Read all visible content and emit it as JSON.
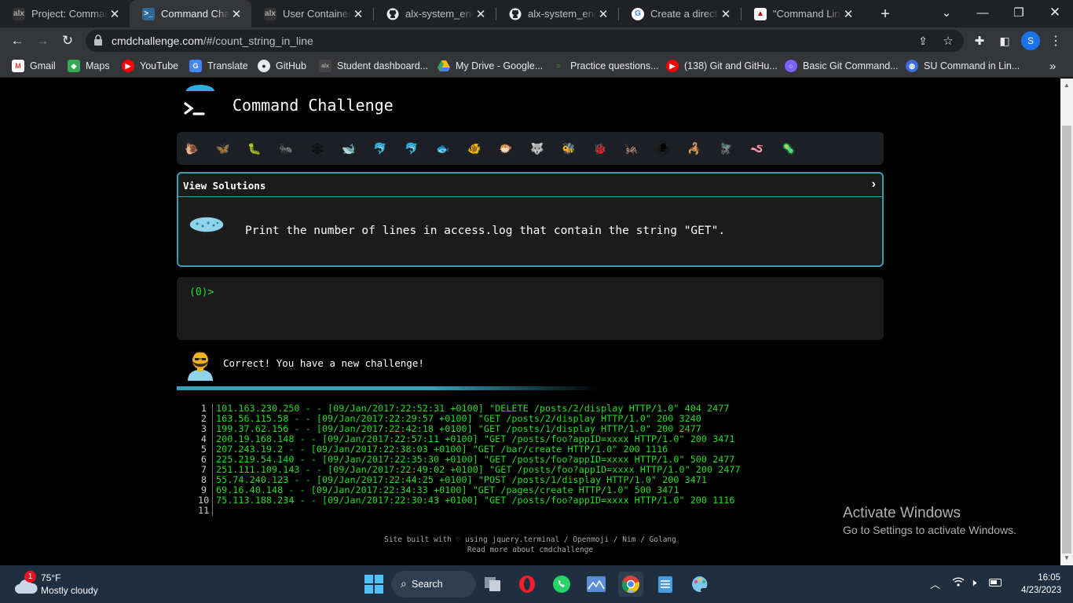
{
  "browser": {
    "tabs": [
      {
        "title": "Project: Comman",
        "active": false,
        "favicon": "alx-icon"
      },
      {
        "title": "Command Challe",
        "active": true,
        "favicon": "terminal-icon"
      },
      {
        "title": "User Containers -",
        "active": false,
        "favicon": "alx-icon"
      },
      {
        "title": "alx-system_engin",
        "active": false,
        "favicon": "github-icon"
      },
      {
        "title": "alx-system_engin",
        "active": false,
        "favicon": "github-icon"
      },
      {
        "title": "Create a directory",
        "active": false,
        "favicon": "google-icon"
      },
      {
        "title": "\"Command Line C",
        "active": false,
        "favicon": "page-icon"
      }
    ],
    "url_domain": "cmdchallenge.com",
    "url_path": "/#/count_string_in_line",
    "profile_initial": "S",
    "bookmarks": [
      {
        "label": "Gmail",
        "icon": "gmail-icon",
        "color": "#ea4335"
      },
      {
        "label": "Maps",
        "icon": "maps-icon",
        "color": "#34a853"
      },
      {
        "label": "YouTube",
        "icon": "youtube-icon",
        "color": "#ff0000"
      },
      {
        "label": "Translate",
        "icon": "translate-icon",
        "color": "#4285f4"
      },
      {
        "label": "GitHub",
        "icon": "github-icon",
        "color": "#ffffff"
      },
      {
        "label": "Student dashboard...",
        "icon": "alx-icon",
        "color": "#444444"
      },
      {
        "label": "My Drive - Google...",
        "icon": "drive-icon",
        "color": "#fbbc04"
      },
      {
        "label": "Practice questions...",
        "icon": "practice-icon",
        "color": "#2d8c3c"
      },
      {
        "label": "(138) Git and GitHu...",
        "icon": "youtube-icon",
        "color": "#ff0000"
      },
      {
        "label": "Basic Git Command...",
        "icon": "circle-icon",
        "color": "#7b61ff"
      },
      {
        "label": "SU Command in Lin...",
        "icon": "globe-icon",
        "color": "#3b6fd8"
      }
    ]
  },
  "page": {
    "site_title": "Command Challenge",
    "critters": [
      "🐌",
      "🦋",
      "🐛",
      "🐜",
      "🕸",
      "🐋",
      "🐬",
      "🐬",
      "🐟",
      "🐠",
      "🐡",
      "🐺",
      "🐝",
      "🐞",
      "🦗",
      "🕷",
      "🦂",
      "🪰",
      "🪱",
      "🦠"
    ],
    "view_solutions_label": "View Solutions",
    "challenge_text": "Print the number of lines in access.log that contain the string \"GET\".",
    "prompt": "(0)>",
    "feedback": "Correct! You have a new challenge!",
    "log_lines": [
      {
        "n": "1",
        "text": "101.163.230.250 - - [09/Jan/2017:22:52:31 +0100] \"DELETE /posts/2/display HTTP/1.0\" 404 2477"
      },
      {
        "n": "2",
        "text": "163.56.115.58 - - [09/Jan/2017:22:29:57 +0100] \"GET /posts/2/display HTTP/1.0\" 200 3240"
      },
      {
        "n": "3",
        "text": "199.37.62.156 - - [09/Jan/2017:22:42:18 +0100] \"GET /posts/1/display HTTP/1.0\" 200 2477"
      },
      {
        "n": "4",
        "text": "200.19.168.148 - - [09/Jan/2017:22:57:11 +0100] \"GET /posts/foo?appID=xxxx HTTP/1.0\" 200 3471"
      },
      {
        "n": "5",
        "text": "207.243.19.2 - - [09/Jan/2017:22:38:03 +0100] \"GET /bar/create HTTP/1.0\" 200 1116"
      },
      {
        "n": "6",
        "text": "225.219.54.140 - - [09/Jan/2017:22:35:30 +0100] \"GET /posts/foo?appID=xxxx HTTP/1.0\" 500 2477"
      },
      {
        "n": "7",
        "text": "251.111.109.143 - - [09/Jan/2017:22:49:02 +0100] \"GET /posts/foo?appID=xxxx HTTP/1.0\" 200 2477"
      },
      {
        "n": "8",
        "text": "55.74.240.123 - - [09/Jan/2017:22:44:25 +0100] \"POST /posts/1/display HTTP/1.0\" 200 3471"
      },
      {
        "n": "9",
        "text": "69.16.40.148 - - [09/Jan/2017:22:34:33 +0100] \"GET /pages/create HTTP/1.0\" 500 3471"
      },
      {
        "n": "10",
        "text": "75.113.188.234 - - [09/Jan/2017:22:30:43 +0100] \"GET /posts/foo?appID=xxxx HTTP/1.0\" 200 1116"
      },
      {
        "n": "11",
        "text": ""
      }
    ],
    "footer_line1": "Site built with ♡ using jquery.terminal / Openmoji / Nim / Golang",
    "footer_line2": "Read more about cmdchallenge"
  },
  "watermark": {
    "title": "Activate Windows",
    "subtitle": "Go to Settings to activate Windows."
  },
  "taskbar": {
    "temperature": "75°F",
    "condition": "Mostly cloudy",
    "weather_badge": "1",
    "search_label": "Search",
    "time": "16:05",
    "date": "4/23/2023"
  },
  "colors": {
    "accent": "#3a9fb3",
    "terminal_green": "#22dd22",
    "chrome_dark": "#202124",
    "chrome_toolbar": "#35363a",
    "taskbar": "#1f2f3f"
  }
}
